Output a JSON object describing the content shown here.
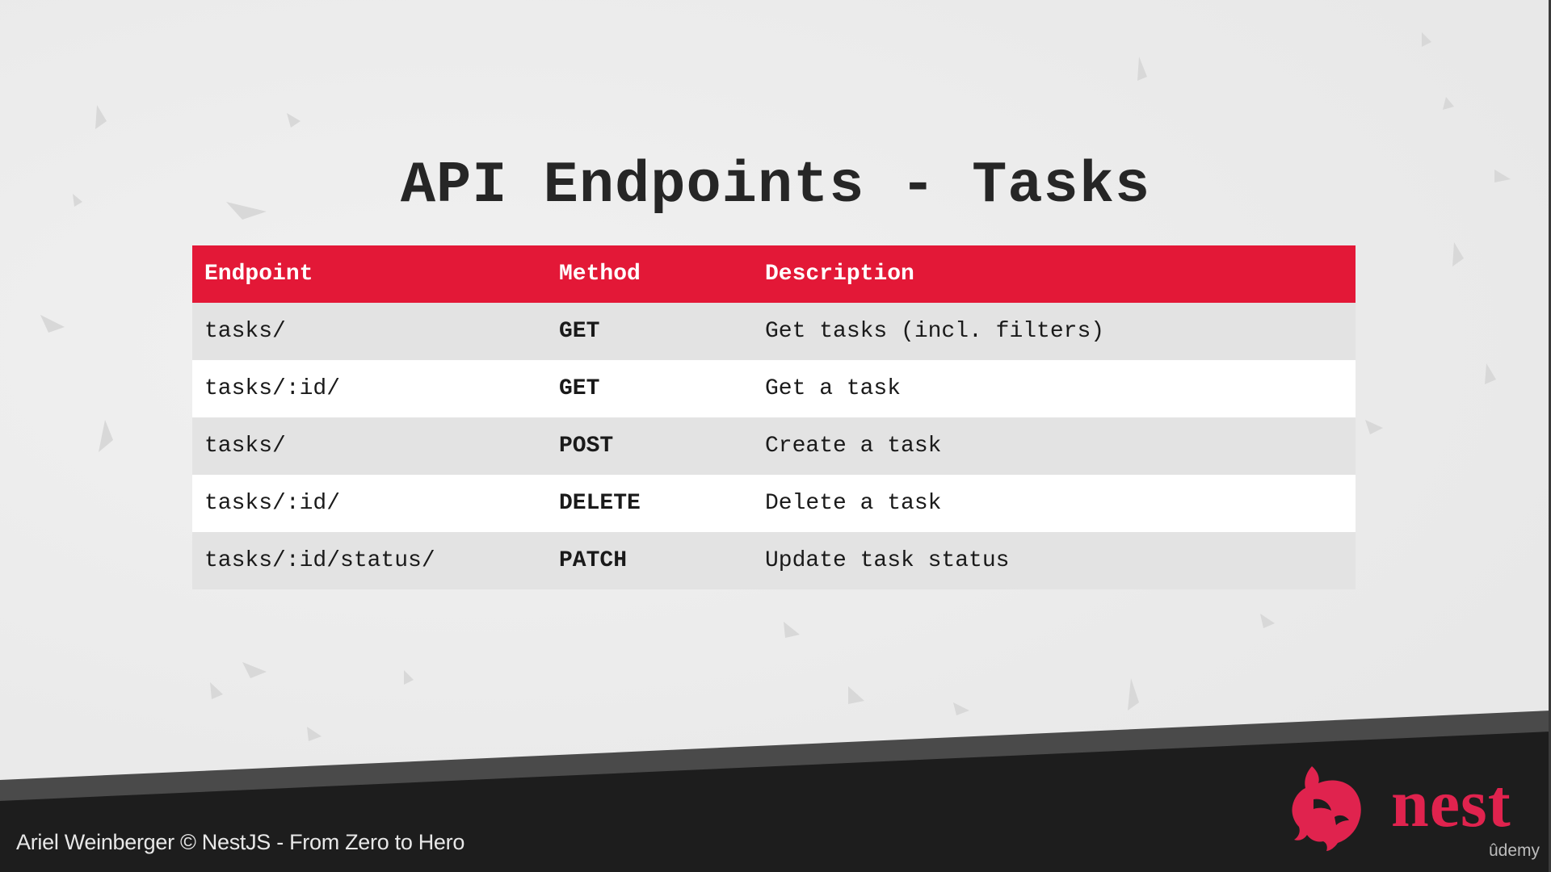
{
  "slide": {
    "title": "API Endpoints - Tasks"
  },
  "table": {
    "headers": [
      "Endpoint",
      "Method",
      "Description"
    ],
    "rows": [
      {
        "endpoint": "tasks/",
        "method": "GET",
        "description": "Get tasks (incl. filters)"
      },
      {
        "endpoint": "tasks/:id/",
        "method": "GET",
        "description": "Get a task"
      },
      {
        "endpoint": "tasks/",
        "method": "POST",
        "description": "Create a task"
      },
      {
        "endpoint": "tasks/:id/",
        "method": "DELETE",
        "description": "Delete a task"
      },
      {
        "endpoint": "tasks/:id/status/",
        "method": "PATCH",
        "description": "Update task status"
      }
    ]
  },
  "footer": {
    "credit": "Ariel Weinberger © NestJS - From Zero to Hero",
    "logo_text": "nest",
    "watermark": "ûdemy"
  },
  "colors": {
    "header_bg": "#e31837",
    "brand_red": "#e0234e",
    "footer_bg": "#1d1d1d",
    "title_text": "#262626"
  },
  "icons": {
    "logo": "nestjs-cat-icon"
  }
}
